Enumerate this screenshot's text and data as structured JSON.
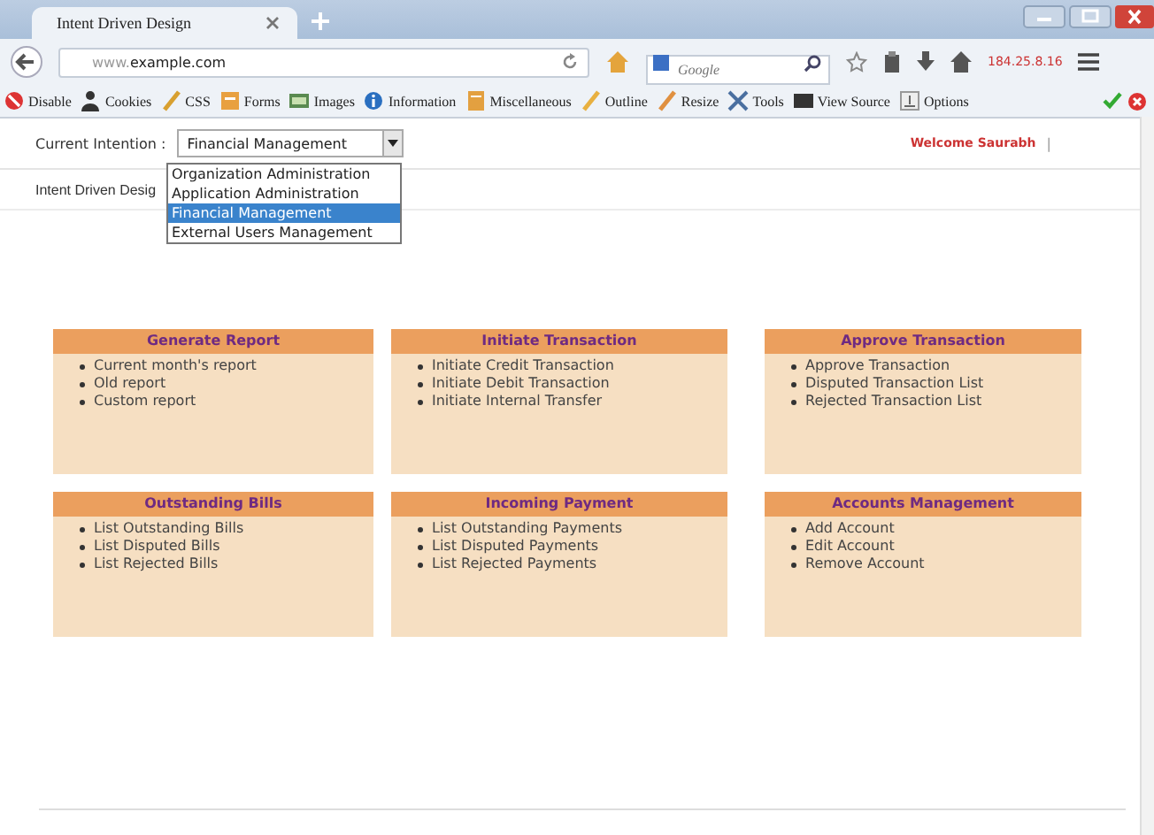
{
  "browser": {
    "tab_title": "Intent Driven Design",
    "url_prefix": "www.",
    "url_domain": "example.com",
    "search_placeholder": "Google",
    "ip": "184.25.8.16"
  },
  "toolbar": [
    "Disable",
    "Cookies",
    "CSS",
    "Forms",
    "Images",
    "Information",
    "Miscellaneous",
    "Outline",
    "Resize",
    "Tools",
    "View Source",
    "Options"
  ],
  "header": {
    "intention_label": "Current Intention :",
    "intention_value": "Financial Management",
    "welcome": "Welcome Saurabh",
    "separator": "|"
  },
  "dropdown": [
    {
      "label": "Organization Administration",
      "selected": false
    },
    {
      "label": "Application Administration",
      "selected": false
    },
    {
      "label": "Financial Management",
      "selected": true
    },
    {
      "label": "External Users Management",
      "selected": false
    }
  ],
  "breadcrumb": "Intent Driven Desig",
  "cards": [
    {
      "title": "Generate Report",
      "items": [
        "Current month's report",
        "Old report",
        "Custom report"
      ]
    },
    {
      "title": "Initiate Transaction",
      "items": [
        "Initiate Credit Transaction",
        "Initiate Debit Transaction",
        "Initiate Internal Transfer"
      ]
    },
    {
      "title": "Approve Transaction",
      "items": [
        "Approve Transaction",
        "Disputed Transaction List",
        "Rejected Transaction List"
      ]
    },
    {
      "title": "Outstanding Bills",
      "items": [
        "List Outstanding Bills",
        "List Disputed Bills",
        "List Rejected Bills"
      ]
    },
    {
      "title": "Incoming Payment",
      "items": [
        "List Outstanding Payments",
        "List Disputed Payments",
        "List Rejected Payments"
      ]
    },
    {
      "title": "Accounts Management",
      "items": [
        "Add Account",
        "Edit Account",
        "Remove Account"
      ]
    }
  ]
}
